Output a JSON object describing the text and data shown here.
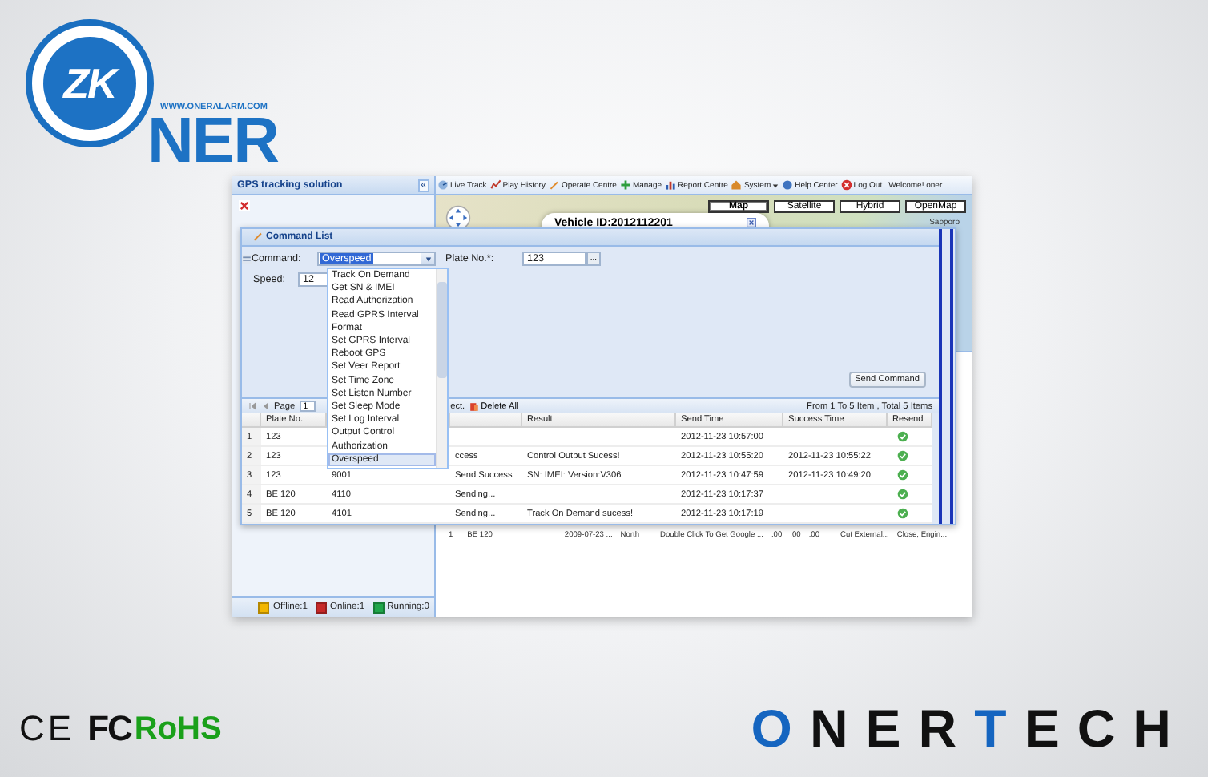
{
  "logo": {
    "mark": "ZK",
    "url": "WWW.ONERALARM.COM",
    "word": "NER"
  },
  "app": {
    "left_panel": {
      "title": "GPS tracking solution",
      "collapse": "«",
      "legend": [
        {
          "label": "Offline:1",
          "color": "#f2b600"
        },
        {
          "label": "Online:1",
          "color": "#c62828"
        },
        {
          "label": "Running:0",
          "color": "#1fa64a"
        }
      ]
    },
    "toolbar": [
      {
        "label": "Live Track",
        "has_menu": false
      },
      {
        "label": "Play History",
        "has_menu": false
      },
      {
        "label": "Operate Centre",
        "has_menu": false
      },
      {
        "label": "Manage",
        "has_menu": false
      },
      {
        "label": "Report Centre",
        "has_menu": false
      },
      {
        "label": "System",
        "has_menu": true
      },
      {
        "label": "Help Center",
        "has_menu": false
      },
      {
        "label": "Log Out",
        "has_menu": false
      }
    ],
    "welcome": "Welcome! oner",
    "map": {
      "types": [
        {
          "label": "Map",
          "selected": true
        },
        {
          "label": "Satellite",
          "selected": false
        },
        {
          "label": "Hybrid",
          "selected": false
        },
        {
          "label": "OpenMap",
          "selected": false
        }
      ],
      "popup_title": "Vehicle ID:2012112201",
      "place": "Sapporo"
    },
    "background_row": [
      "1",
      "BE 120",
      "2009-07-23 ...",
      "North",
      "Double Click To Get Google ...",
      ".00",
      ".00",
      ".00",
      "Cut External...",
      "Close, Engin..."
    ],
    "dialog": {
      "title": "Command List",
      "command": {
        "label": "Command:",
        "value": "Overspeed",
        "options": [
          {
            "label": "Track On Demand",
            "selected": false
          },
          {
            "label": "Get SN & IMEI",
            "selected": false
          },
          {
            "label": "Read Authorization",
            "selected": false
          },
          {
            "label": "Read GPRS Interval",
            "selected": false
          },
          {
            "label": "Format",
            "selected": false
          },
          {
            "label": "Set GPRS Interval",
            "selected": false
          },
          {
            "label": "Reboot GPS",
            "selected": false
          },
          {
            "label": "Set Veer Report",
            "selected": false
          },
          {
            "label": "Set Time Zone",
            "selected": false
          },
          {
            "label": "Set Listen Number",
            "selected": false
          },
          {
            "label": "Set Sleep Mode",
            "selected": false
          },
          {
            "label": "Set Log Interval",
            "selected": false
          },
          {
            "label": "Output Control",
            "selected": false
          },
          {
            "label": "Authorization",
            "selected": false
          },
          {
            "label": "Overspeed",
            "selected": true
          }
        ]
      },
      "plate": {
        "label": "Plate No.*:",
        "value": "123",
        "browse": "..."
      },
      "speed": {
        "label": "Speed:",
        "value": "12"
      },
      "send_button": "Send Command",
      "pager": {
        "page_label": "Page",
        "page": "1",
        "select_fragment": "ect.",
        "delete_all": "Delete All",
        "summary": "From 1 To 5 Item , Total 5 Items"
      },
      "table": {
        "columns": [
          "",
          "Plate No.",
          "",
          "",
          "Result",
          "Send Time",
          "Success Time",
          "Resend"
        ],
        "rows": [
          {
            "cells": [
              "1",
              "123",
              "",
              "",
              "",
              "2012-11-23 10:57:00",
              ""
            ]
          },
          {
            "cells": [
              "2",
              "123",
              "",
              "ccess",
              "Control Output Sucess!",
              "2012-11-23 10:55:20",
              "2012-11-23 10:55:22"
            ]
          },
          {
            "cells": [
              "3",
              "123",
              "9001",
              "Send Success",
              "SN: IMEI: Version:V306",
              "2012-11-23 10:47:59",
              "2012-11-23 10:49:20"
            ]
          },
          {
            "cells": [
              "4",
              "BE 120",
              "4110",
              "Sending...",
              "",
              "2012-11-23 10:17:37",
              ""
            ]
          },
          {
            "cells": [
              "5",
              "BE 120",
              "4101",
              "Sending...",
              "Track On Demand sucess!",
              "2012-11-23 10:17:19",
              ""
            ]
          }
        ]
      }
    }
  },
  "certifications": [
    {
      "label": "CE",
      "kind": "ce"
    },
    {
      "label": "FC",
      "kind": "fcc"
    },
    {
      "label": "RoHS",
      "kind": "rohs"
    }
  ],
  "brand": {
    "parts": [
      {
        "text": "O",
        "color": "#1565c0"
      },
      {
        "text": "NER",
        "color": "#111111"
      },
      {
        "text": "T",
        "color": "#1565c0"
      },
      {
        "text": "ECH",
        "color": "#111111"
      }
    ]
  }
}
